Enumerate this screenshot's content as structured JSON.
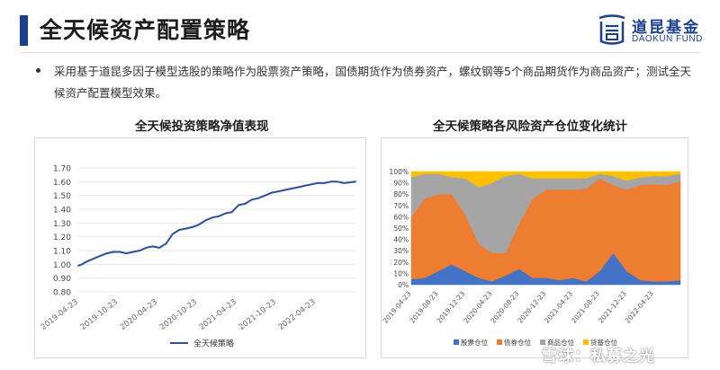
{
  "header": {
    "title": "全天候资产配置策略",
    "logo_cn": "道昆基金",
    "logo_en": "DAOKUN FUND",
    "accent": "#1a3f8f"
  },
  "bullet": {
    "text": "采用基于道昆多因子模型选股的策略作为股票资产策略，国债期货作为债券资产，螺纹钢等5个商品期货作为商品资产；测试全天候资产配置模型效果。"
  },
  "chart_data": [
    {
      "type": "line",
      "title": "全天候投资策略净值表现",
      "yticks": [
        "0.80",
        "0.90",
        "1.00",
        "1.10",
        "1.20",
        "1.30",
        "1.40",
        "1.50",
        "1.60",
        "1.70"
      ],
      "ylim": [
        0.8,
        1.7
      ],
      "xticks": [
        "2019-04-23",
        "2019-10-23",
        "2020-04-23",
        "2020-10-23",
        "2021-04-23",
        "2021-10-23",
        "2022-04-23"
      ],
      "xlim": [
        "2019-04-23",
        "2022-10-23"
      ],
      "grid": "horizontal",
      "legend_position": "bottom",
      "series": [
        {
          "name": "全天候策略",
          "color": "#2e4f9e",
          "x": [
            "2019-04-23",
            "2019-05-10",
            "2019-06-01",
            "2019-07-01",
            "2019-08-01",
            "2019-09-01",
            "2019-10-01",
            "2019-11-01",
            "2019-12-01",
            "2020-01-01",
            "2020-02-01",
            "2020-03-01",
            "2020-04-01",
            "2020-05-01",
            "2020-06-01",
            "2020-07-01",
            "2020-08-01",
            "2020-09-01",
            "2020-10-01",
            "2020-11-01",
            "2020-12-01",
            "2021-01-01",
            "2021-02-01",
            "2021-03-01",
            "2021-04-01",
            "2021-05-01",
            "2021-06-01",
            "2021-07-01",
            "2021-08-01",
            "2021-09-01",
            "2021-10-01",
            "2021-11-01",
            "2021-12-01",
            "2022-01-01",
            "2022-02-01",
            "2022-03-01",
            "2022-04-01",
            "2022-05-01",
            "2022-06-01",
            "2022-07-01",
            "2022-08-01",
            "2022-09-01",
            "2022-10-23"
          ],
          "values": [
            0.99,
            1.0,
            1.02,
            1.04,
            1.06,
            1.08,
            1.09,
            1.09,
            1.08,
            1.09,
            1.1,
            1.12,
            1.13,
            1.12,
            1.15,
            1.22,
            1.25,
            1.26,
            1.27,
            1.29,
            1.32,
            1.34,
            1.35,
            1.37,
            1.38,
            1.43,
            1.44,
            1.47,
            1.48,
            1.5,
            1.52,
            1.53,
            1.54,
            1.55,
            1.56,
            1.57,
            1.58,
            1.59,
            1.59,
            1.6,
            1.6,
            1.59,
            1.6
          ]
        }
      ]
    },
    {
      "type": "area",
      "stacked": "percent",
      "title": "全天候策略各风险资产仓位变化统计",
      "yticks": [
        "0%",
        "10%",
        "20%",
        "30%",
        "40%",
        "50%",
        "60%",
        "70%",
        "80%",
        "90%",
        "100%"
      ],
      "ylim": [
        0,
        100
      ],
      "xticks": [
        "2019-04-23",
        "2019-08-23",
        "2019-12-23",
        "2020-04-23",
        "2020-08-23",
        "2020-12-23",
        "2021-04-23",
        "2021-08-23",
        "2021-12-23",
        "2022-04-23"
      ],
      "xlim": [
        "2019-04-23",
        "2022-08-23"
      ],
      "legend_position": "bottom",
      "x": [
        "2019-04-23",
        "2019-06-23",
        "2019-08-23",
        "2019-10-23",
        "2019-12-23",
        "2020-02-23",
        "2020-04-23",
        "2020-06-23",
        "2020-08-23",
        "2020-10-23",
        "2020-12-23",
        "2021-02-23",
        "2021-04-23",
        "2021-06-23",
        "2021-08-23",
        "2021-10-23",
        "2021-12-23",
        "2022-02-23",
        "2022-04-23",
        "2022-06-23",
        "2022-08-23"
      ],
      "series": [
        {
          "name": "股票仓位",
          "color": "#4472c4",
          "values": [
            5,
            6,
            12,
            18,
            12,
            6,
            3,
            8,
            14,
            6,
            6,
            4,
            6,
            3,
            12,
            28,
            12,
            4,
            3,
            3,
            4
          ]
        },
        {
          "name": "债券仓位",
          "color": "#ed7d31",
          "values": [
            55,
            70,
            68,
            62,
            50,
            30,
            25,
            20,
            40,
            70,
            78,
            80,
            78,
            82,
            82,
            60,
            72,
            84,
            86,
            85,
            88
          ]
        },
        {
          "name": "商品仓位",
          "color": "#a5a5a5",
          "values": [
            35,
            22,
            18,
            15,
            32,
            50,
            62,
            68,
            44,
            18,
            10,
            10,
            10,
            9,
            4,
            8,
            8,
            7,
            7,
            8,
            6
          ]
        },
        {
          "name": "货基仓位",
          "color": "#ffc000",
          "values": [
            5,
            2,
            2,
            5,
            6,
            14,
            10,
            4,
            2,
            6,
            6,
            6,
            6,
            6,
            2,
            4,
            8,
            5,
            4,
            4,
            2
          ]
        }
      ]
    }
  ],
  "watermark": "雪球：私募之光"
}
